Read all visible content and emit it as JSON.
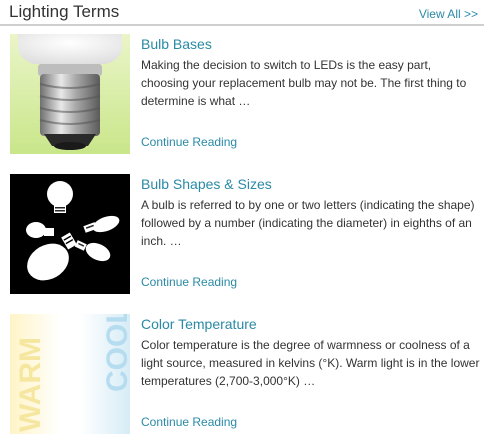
{
  "header": {
    "title": "Lighting Terms",
    "view_all": "View All >>"
  },
  "articles": [
    {
      "title": "Bulb Bases",
      "excerpt": "Making the decision to switch to LEDs is the easy part, choosing your replacement bulb may not be. The first thing to determine is what …",
      "link": "Continue Reading"
    },
    {
      "title": "Bulb Shapes & Sizes",
      "excerpt": "A bulb is referred to by one or two letters (indicating the shape) followed by a number (indicating the diameter) in eighths of an inch. …",
      "link": "Continue Reading"
    },
    {
      "title": "Color Temperature",
      "excerpt": "Color temperature is the degree of warmness or coolness of a light source, measured in kelvins (°K). Warm light is in the lower temperatures (2,700-3,000°K) …",
      "link": "Continue Reading",
      "thumb_warm": "WARM",
      "thumb_cool": "COOL"
    }
  ],
  "colors": {
    "accent": "#2a8aa6",
    "divider": "#cfcfcf",
    "text": "#333333"
  }
}
